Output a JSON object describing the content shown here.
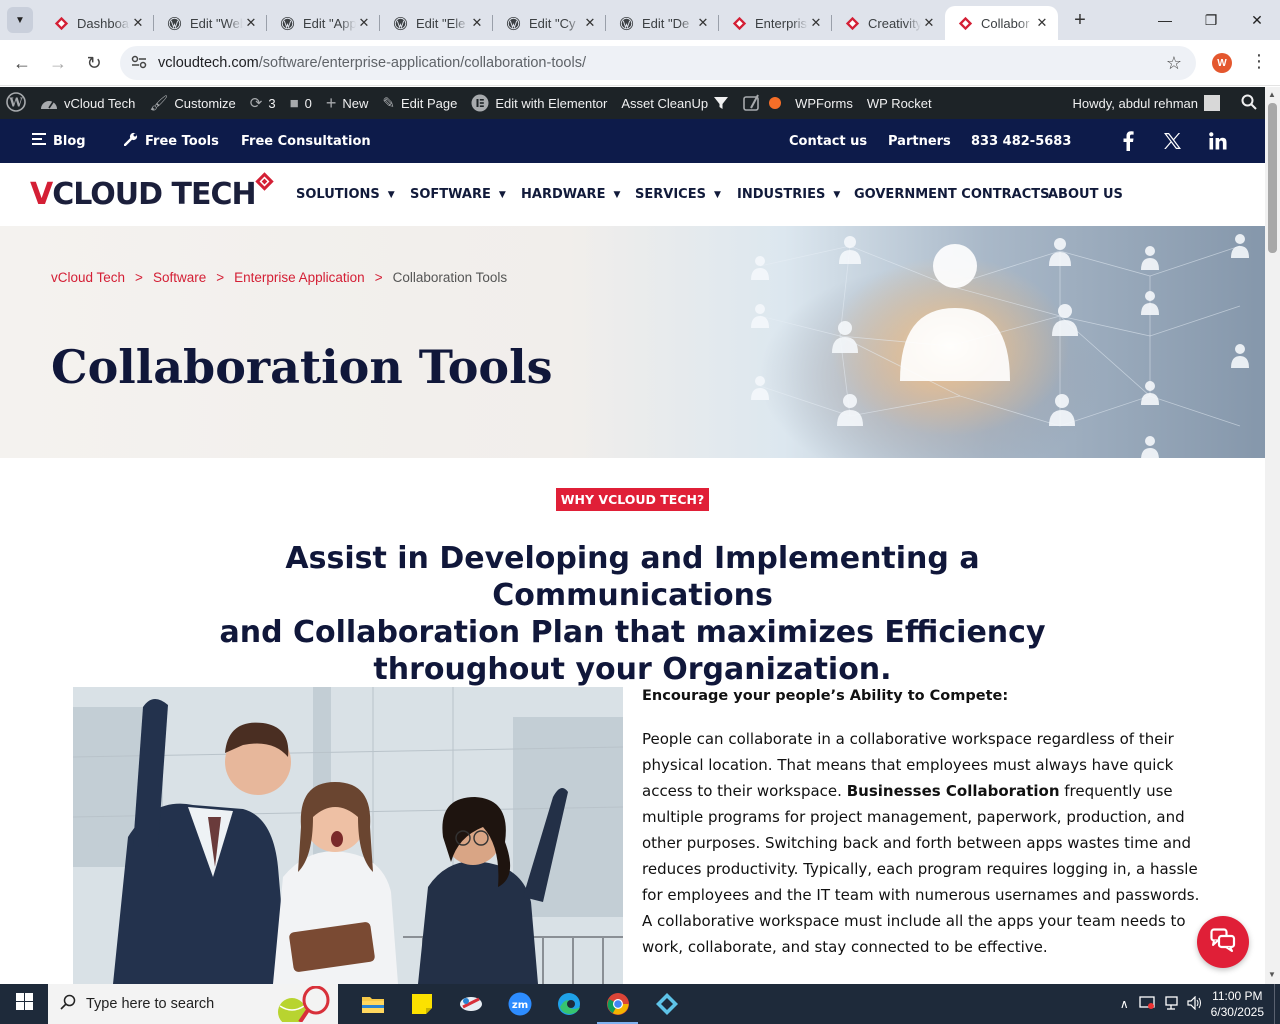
{
  "browser": {
    "tabs": [
      {
        "label": "Dashboard",
        "icon": "vcloud-diamond-icon"
      },
      {
        "label": "Edit \"Web",
        "icon": "wordpress-icon"
      },
      {
        "label": "Edit \"App",
        "icon": "wordpress-icon"
      },
      {
        "label": "Edit \"Ele",
        "icon": "wordpress-icon"
      },
      {
        "label": "Edit \"Cy",
        "icon": "wordpress-icon"
      },
      {
        "label": "Edit \"De",
        "icon": "wordpress-icon"
      },
      {
        "label": "Enterprise",
        "icon": "vcloud-diamond-icon"
      },
      {
        "label": "Creativity",
        "icon": "vcloud-diamond-icon"
      },
      {
        "label": "Collabor",
        "icon": "vcloud-diamond-icon",
        "active": true
      }
    ],
    "url_host": "vcloudtech.com",
    "url_path": "/software/enterprise-application/collaboration-tools/",
    "profile_initial": "W"
  },
  "adminbar": {
    "site_name": "vCloud Tech",
    "customize": "Customize",
    "updates_count": "3",
    "comments_count": "0",
    "new_label": "New",
    "edit_page": "Edit Page",
    "edit_elementor": "Edit with Elementor",
    "asset_cleanup": "Asset CleanUp",
    "wpforms": "WPForms",
    "wp_rocket": "WP Rocket",
    "howdy": "Howdy, abdul rehman"
  },
  "topbar": {
    "blog": "Blog",
    "free_tools": "Free Tools",
    "free_consultation": "Free Consultation",
    "contact": "Contact us",
    "partners": "Partners",
    "phone": "833 482-5683"
  },
  "logo": {
    "v": "V",
    "rest": "CLOUD TECH"
  },
  "menu": [
    {
      "label": "SOLUTIONS",
      "caret": true
    },
    {
      "label": "SOFTWARE",
      "caret": true
    },
    {
      "label": "HARDWARE",
      "caret": true
    },
    {
      "label": "SERVICES",
      "caret": true
    },
    {
      "label": "INDUSTRIES",
      "caret": true
    },
    {
      "label": "GOVERNMENT CONTRACTS",
      "caret": false
    },
    {
      "label": "ABOUT US",
      "caret": false
    }
  ],
  "breadcrumb": {
    "home": "vCloud Tech",
    "level1": "Software",
    "level2": "Enterprise Application",
    "current": "Collaboration Tools",
    "separator": ">"
  },
  "hero": {
    "title": "Collaboration Tools"
  },
  "section": {
    "badge": "WHY VCLOUD TECH?",
    "headline_line1": "Assist in Developing and Implementing a Communications",
    "headline_line2": "and Collaboration Plan that maximizes Efficiency",
    "headline_line3": "throughout your Organization.",
    "subheading": "Encourage your people’s Ability to Compete:",
    "para_before_bold": "People can collaborate in a collaborative workspace regardless of their physical location. That means that employees must always have quick access to their workspace. ",
    "para_bold": "Businesses Collaboration",
    "para_after_bold": " frequently use multiple programs for project management, paperwork, production, and other purposes. Switching back and forth between apps wastes time and reduces productivity. Typically, each program requires logging in, a hassle for employees and the IT team with numerous usernames and passwords. A collaborative workspace must include all the apps your team needs to work, collaborate, and stay connected to be effective."
  },
  "taskbar": {
    "search_placeholder": "Type here to search",
    "time": "11:00 PM",
    "date": "6/30/2025"
  },
  "colors": {
    "brand_red": "#e01f37",
    "navy": "#0d1b4a",
    "admin_bar": "#1d2327"
  }
}
